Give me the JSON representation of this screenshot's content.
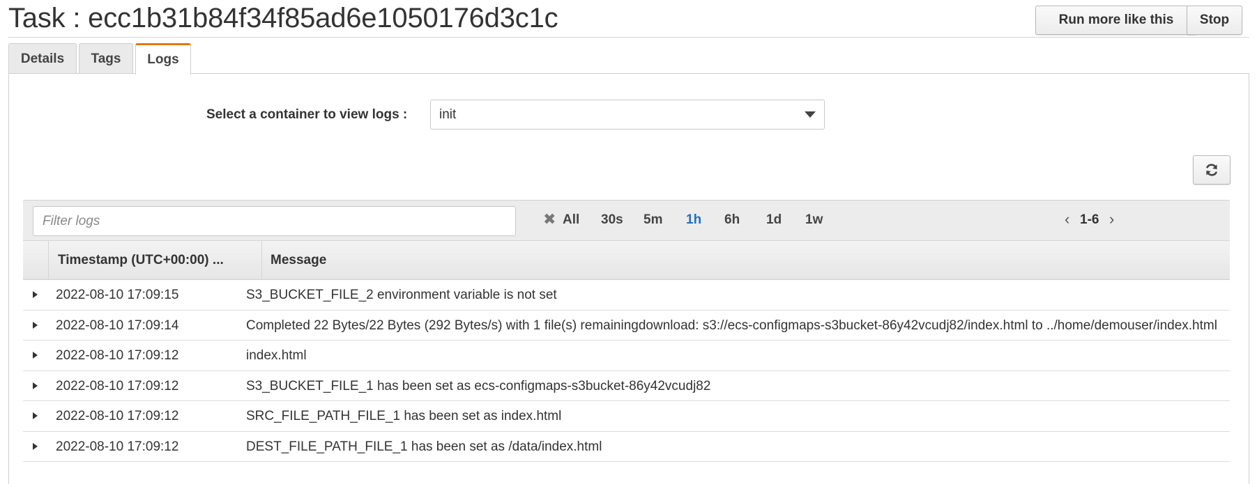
{
  "header": {
    "title": "Task : ecc1b31b84f34f85ad6e1050176d3c1c",
    "run_more_label": "Run more like this",
    "stop_label": "Stop"
  },
  "tabs": [
    {
      "label": "Details",
      "active": false
    },
    {
      "label": "Tags",
      "active": false
    },
    {
      "label": "Logs",
      "active": true
    }
  ],
  "container_select": {
    "label": "Select a container to view logs :",
    "value": "init"
  },
  "refresh": {
    "icon": "refresh-icon"
  },
  "filter": {
    "placeholder": "Filter logs",
    "value": "",
    "clear_icon": "clear-icon"
  },
  "time_ranges": [
    "All",
    "30s",
    "5m",
    "1h",
    "6h",
    "1d",
    "1w"
  ],
  "active_range": "1h",
  "pager": {
    "text": "1-6"
  },
  "table": {
    "columns": [
      "Timestamp (UTC+00:00) ...",
      "Message"
    ],
    "rows": [
      {
        "timestamp": "2022-08-10 17:09:15",
        "message": "S3_BUCKET_FILE_2 environment variable is not set"
      },
      {
        "timestamp": "2022-08-10 17:09:14",
        "message": "Completed 22 Bytes/22 Bytes (292 Bytes/s) with 1 file(s) remainingdownload: s3://ecs-configmaps-s3bucket-86y42vcudj82/index.html to ../home/demouser/index.html"
      },
      {
        "timestamp": "2022-08-10 17:09:12",
        "message": "index.html"
      },
      {
        "timestamp": "2022-08-10 17:09:12",
        "message": "S3_BUCKET_FILE_1 has been set as ecs-configmaps-s3bucket-86y42vcudj82"
      },
      {
        "timestamp": "2022-08-10 17:09:12",
        "message": "SRC_FILE_PATH_FILE_1 has been set as index.html"
      },
      {
        "timestamp": "2022-08-10 17:09:12",
        "message": "DEST_FILE_PATH_FILE_1 has been set as /data/index.html"
      }
    ]
  },
  "colors": {
    "active_tab_accent": "#e07b00",
    "active_range": "#1f6fbf"
  }
}
